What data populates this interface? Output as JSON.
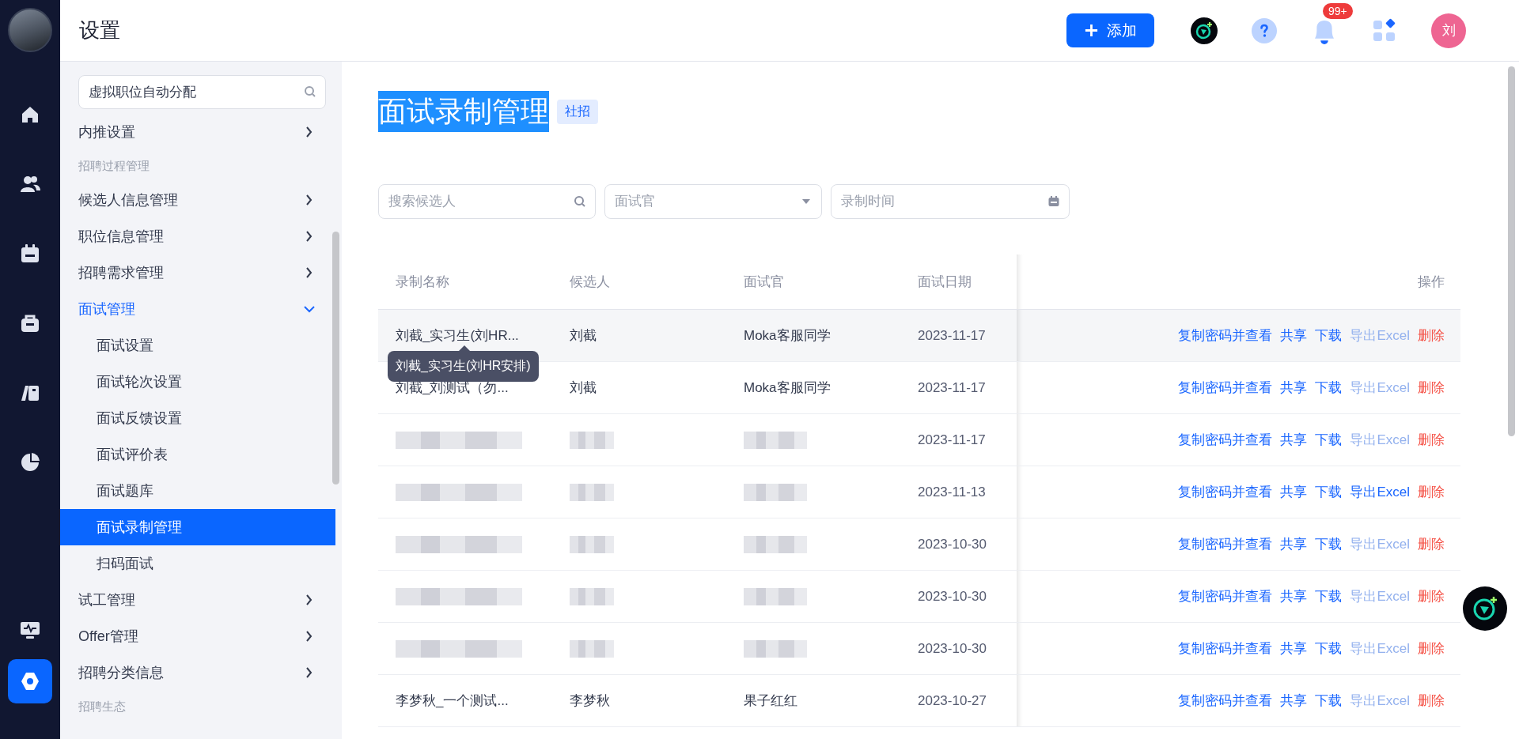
{
  "nav_rail": {
    "items": [
      {
        "kind": "home",
        "selected": false
      },
      {
        "kind": "people",
        "selected": false
      },
      {
        "kind": "calendar",
        "selected": false
      },
      {
        "kind": "bag",
        "selected": false
      },
      {
        "kind": "book",
        "selected": false
      },
      {
        "kind": "chart",
        "selected": false
      },
      {
        "kind": "monitor",
        "selected": false
      },
      {
        "kind": "settings",
        "selected": true
      }
    ]
  },
  "header": {
    "title": "设置",
    "add_button": "添加",
    "notification_count": "99+",
    "avatar_initial": "刘"
  },
  "sidebar": {
    "search_value": "虚拟职位自动分配",
    "items": [
      {
        "kind": "item",
        "label": "内推设置",
        "expanded": false
      },
      {
        "kind": "group",
        "label": "招聘过程管理"
      },
      {
        "kind": "item",
        "label": "候选人信息管理",
        "expanded": false
      },
      {
        "kind": "item",
        "label": "职位信息管理",
        "expanded": false
      },
      {
        "kind": "item",
        "label": "招聘需求管理",
        "expanded": false
      },
      {
        "kind": "item",
        "label": "面试管理",
        "expanded": true,
        "children": [
          {
            "label": "面试设置",
            "selected": false
          },
          {
            "label": "面试轮次设置",
            "selected": false
          },
          {
            "label": "面试反馈设置",
            "selected": false
          },
          {
            "label": "面试评价表",
            "selected": false
          },
          {
            "label": "面试题库",
            "selected": false
          },
          {
            "label": "面试录制管理",
            "selected": true
          },
          {
            "label": "扫码面试",
            "selected": false
          }
        ]
      },
      {
        "kind": "item",
        "label": "试工管理",
        "expanded": false
      },
      {
        "kind": "item",
        "label": "Offer管理",
        "expanded": false
      },
      {
        "kind": "item",
        "label": "招聘分类信息",
        "expanded": false
      },
      {
        "kind": "group",
        "label": "招聘生态"
      }
    ]
  },
  "page": {
    "title": "面试录制管理",
    "title_highlighted": true,
    "tag": "社招"
  },
  "filters": {
    "search_placeholder": "搜索候选人",
    "interviewer_placeholder": "面试官",
    "date_placeholder": "录制时间"
  },
  "table": {
    "columns": [
      "录制名称",
      "候选人",
      "面试官",
      "面试日期",
      "操作"
    ],
    "rows": [
      {
        "redacted": false,
        "hovered": true,
        "name": "刘截_实习生(刘HR...",
        "candidate": "刘截",
        "interviewer": "Moka客服同学",
        "date": "2023-11-17",
        "tooltip": "刘截_实习生(刘HR安排)",
        "actions": [
          {
            "label": "复制密码并查看",
            "kind": "link",
            "disabled": false
          },
          {
            "label": "共享",
            "kind": "link",
            "disabled": false
          },
          {
            "label": "下载",
            "kind": "link",
            "disabled": false
          },
          {
            "label": "导出Excel",
            "kind": "link",
            "disabled": true
          },
          {
            "label": "删除",
            "kind": "danger",
            "disabled": false
          }
        ]
      },
      {
        "redacted": false,
        "hovered": false,
        "name": "刘截_刘测试（勿...",
        "candidate": "刘截",
        "interviewer": "Moka客服同学",
        "date": "2023-11-17",
        "actions": [
          {
            "label": "复制密码并查看",
            "kind": "link",
            "disabled": false
          },
          {
            "label": "共享",
            "kind": "link",
            "disabled": false
          },
          {
            "label": "下载",
            "kind": "link",
            "disabled": false
          },
          {
            "label": "导出Excel",
            "kind": "link",
            "disabled": true
          },
          {
            "label": "删除",
            "kind": "danger",
            "disabled": false
          }
        ]
      },
      {
        "redacted": true,
        "hovered": false,
        "date": "2023-11-17",
        "actions": [
          {
            "label": "复制密码并查看",
            "kind": "link",
            "disabled": false
          },
          {
            "label": "共享",
            "kind": "link",
            "disabled": false
          },
          {
            "label": "下载",
            "kind": "link",
            "disabled": false
          },
          {
            "label": "导出Excel",
            "kind": "link",
            "disabled": true
          },
          {
            "label": "删除",
            "kind": "danger",
            "disabled": false
          }
        ]
      },
      {
        "redacted": true,
        "hovered": false,
        "date": "2023-11-13",
        "actions": [
          {
            "label": "复制密码并查看",
            "kind": "link",
            "disabled": false
          },
          {
            "label": "共享",
            "kind": "link",
            "disabled": false
          },
          {
            "label": "下载",
            "kind": "link",
            "disabled": false
          },
          {
            "label": "导出Excel",
            "kind": "link",
            "disabled": false
          },
          {
            "label": "删除",
            "kind": "danger",
            "disabled": false
          }
        ]
      },
      {
        "redacted": true,
        "hovered": false,
        "date": "2023-10-30",
        "actions": [
          {
            "label": "复制密码并查看",
            "kind": "link",
            "disabled": false
          },
          {
            "label": "共享",
            "kind": "link",
            "disabled": false
          },
          {
            "label": "下载",
            "kind": "link",
            "disabled": false
          },
          {
            "label": "导出Excel",
            "kind": "link",
            "disabled": true
          },
          {
            "label": "删除",
            "kind": "danger",
            "disabled": false
          }
        ]
      },
      {
        "redacted": true,
        "hovered": false,
        "date": "2023-10-30",
        "actions": [
          {
            "label": "复制密码并查看",
            "kind": "link",
            "disabled": false
          },
          {
            "label": "共享",
            "kind": "link",
            "disabled": false
          },
          {
            "label": "下载",
            "kind": "link",
            "disabled": false
          },
          {
            "label": "导出Excel",
            "kind": "link",
            "disabled": true
          },
          {
            "label": "删除",
            "kind": "danger",
            "disabled": false
          }
        ]
      },
      {
        "redacted": true,
        "hovered": false,
        "date": "2023-10-30",
        "actions": [
          {
            "label": "复制密码并查看",
            "kind": "link",
            "disabled": false
          },
          {
            "label": "共享",
            "kind": "link",
            "disabled": false
          },
          {
            "label": "下载",
            "kind": "link",
            "disabled": false
          },
          {
            "label": "导出Excel",
            "kind": "link",
            "disabled": true
          },
          {
            "label": "删除",
            "kind": "danger",
            "disabled": false
          }
        ]
      },
      {
        "redacted": false,
        "hovered": false,
        "name": "李梦秋_一个测试...",
        "candidate": "李梦秋",
        "interviewer": "果子红红",
        "date": "2023-10-27",
        "actions": [
          {
            "label": "复制密码并查看",
            "kind": "link",
            "disabled": false
          },
          {
            "label": "共享",
            "kind": "link",
            "disabled": false
          },
          {
            "label": "下载",
            "kind": "link",
            "disabled": false
          },
          {
            "label": "导出Excel",
            "kind": "link",
            "disabled": true
          },
          {
            "label": "删除",
            "kind": "danger",
            "disabled": false
          }
        ]
      }
    ]
  }
}
